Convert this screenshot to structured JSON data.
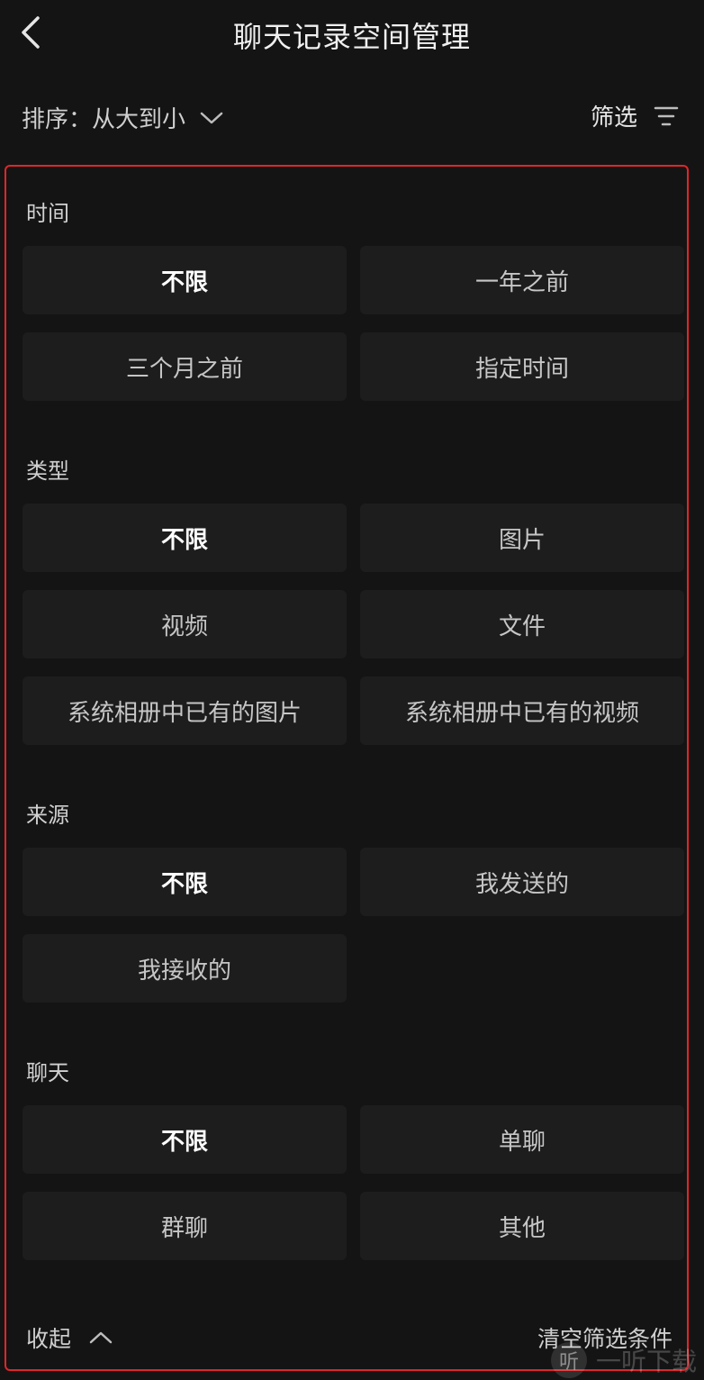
{
  "header": {
    "title": "聊天记录空间管理"
  },
  "sortbar": {
    "sort_label": "排序：从大到小",
    "filter_label": "筛选"
  },
  "sections": {
    "time": {
      "label": "时间",
      "options": [
        "不限",
        "一年之前",
        "三个月之前",
        "指定时间"
      ],
      "selected": "不限"
    },
    "type": {
      "label": "类型",
      "options": [
        "不限",
        "图片",
        "视频",
        "文件",
        "系统相册中已有的图片",
        "系统相册中已有的视频"
      ],
      "selected": "不限"
    },
    "source": {
      "label": "来源",
      "options": [
        "不限",
        "我发送的",
        "我接收的"
      ],
      "selected": "不限"
    },
    "chat": {
      "label": "聊天",
      "options": [
        "不限",
        "单聊",
        "群聊",
        "其他"
      ],
      "selected": "不限"
    }
  },
  "footer": {
    "collapse_label": "收起",
    "clear_label": "清空筛选条件"
  },
  "watermark": {
    "logo": "听",
    "text": "一听下载"
  },
  "colors": {
    "background": "#141414",
    "chip": "#1d1d1d",
    "highlight_border": "#e0262a"
  }
}
